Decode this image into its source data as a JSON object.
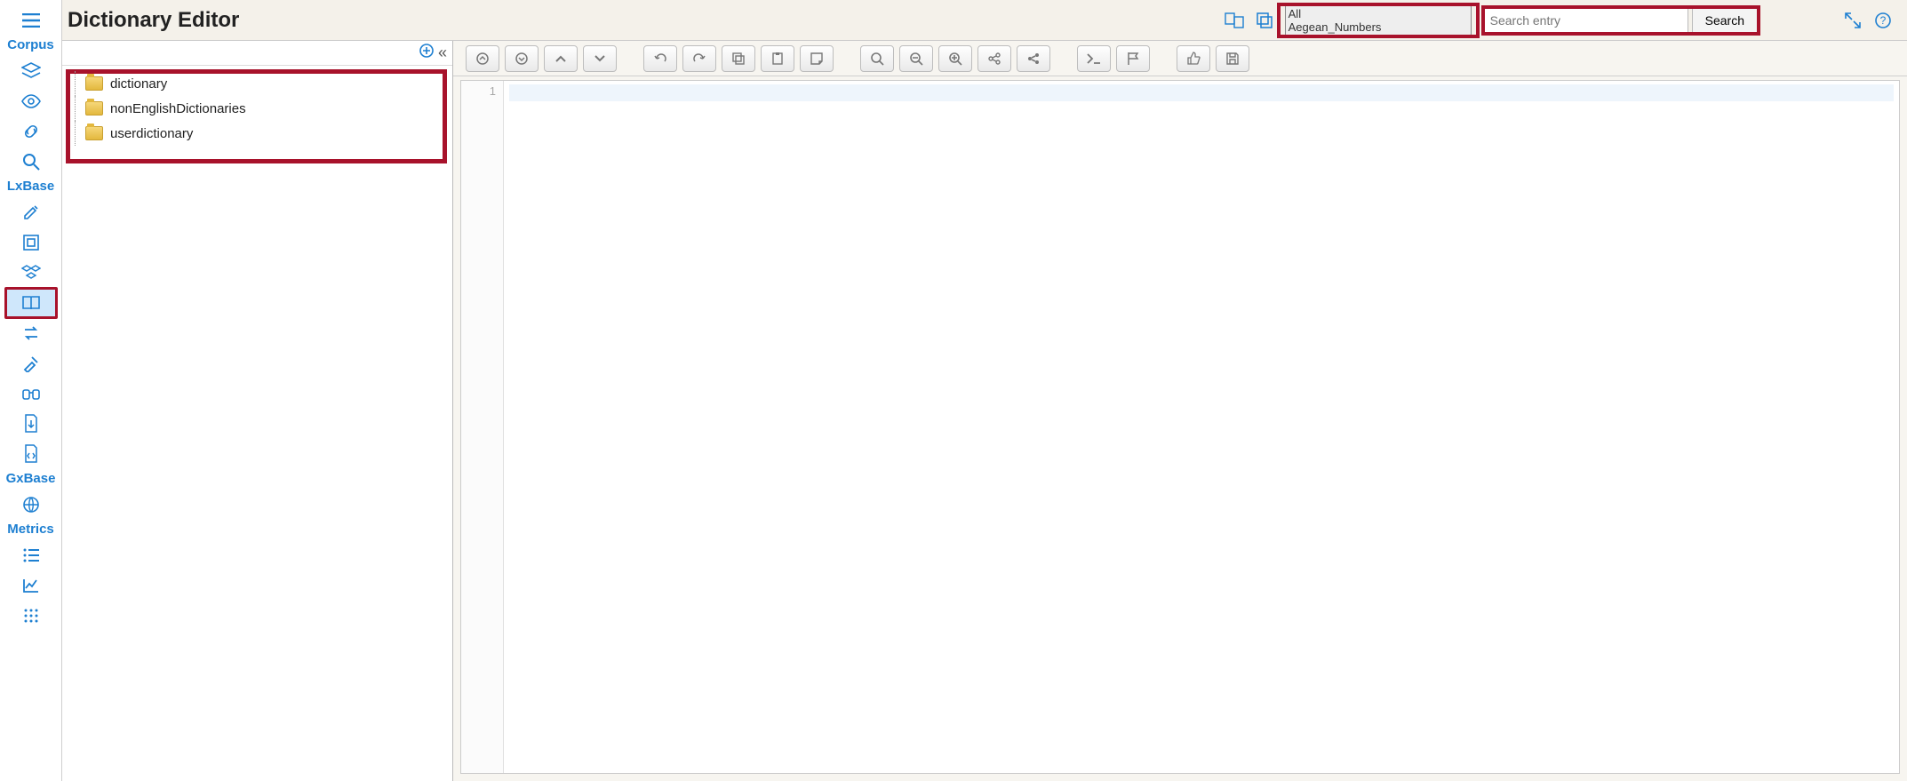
{
  "header": {
    "title": "Dictionary Editor",
    "select_options": [
      "All",
      "Aegean_Numbers"
    ],
    "search_placeholder": "Search entry",
    "search_button": "Search"
  },
  "sidebar": {
    "sections": [
      {
        "label": "Corpus"
      },
      {
        "label": "LxBase"
      },
      {
        "label": "GxBase"
      },
      {
        "label": "Metrics"
      }
    ]
  },
  "tree": {
    "items": [
      {
        "label": "dictionary"
      },
      {
        "label": "nonEnglishDictionaries"
      },
      {
        "label": "userdictionary"
      }
    ]
  },
  "editor": {
    "line_number": "1"
  }
}
